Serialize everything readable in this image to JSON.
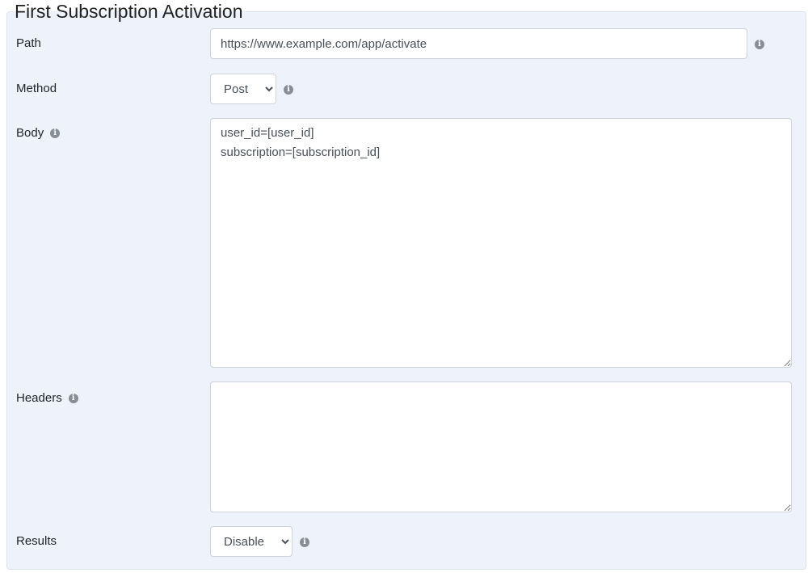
{
  "title": "First Subscription Activation",
  "fields": {
    "path": {
      "label": "Path",
      "value": "https://www.example.com/app/activate"
    },
    "method": {
      "label": "Method",
      "value": "Post",
      "options": [
        "Post"
      ]
    },
    "body": {
      "label": "Body",
      "value": "user_id=[user_id]\nsubscription=[subscription_id]"
    },
    "headers": {
      "label": "Headers",
      "value": ""
    },
    "results": {
      "label": "Results",
      "value": "Disable",
      "options": [
        "Disable"
      ]
    }
  },
  "icons": {
    "info": "info-circle-icon"
  }
}
